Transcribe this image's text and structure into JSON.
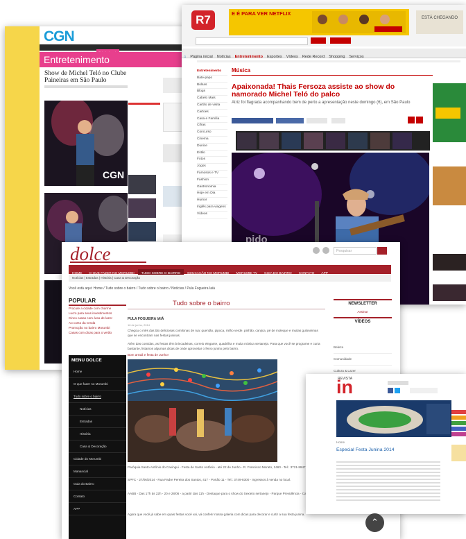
{
  "cgn": {
    "logo": "CGN",
    "nav": [
      "Home",
      "Cidades",
      "Concurso",
      "Esportes",
      "Entretenimento",
      "Blog Metropole",
      "Vídeos"
    ],
    "active_nav": "Entretenimento",
    "section": "Entretenimento",
    "headline": "Show de Michel Teló no Clube Paineiras em São Paulo"
  },
  "r7": {
    "logo": "R7",
    "banner_text": "E É PARA VER NETFLIX",
    "banner2": "ESTÁ CHEGANDO",
    "nav": [
      "Página inicial",
      "Notícias",
      "Entretenimento",
      "Esportes",
      "Vídeos",
      "Rede Record",
      "Shopping",
      "Serviços"
    ],
    "side_head": "Entretenimento",
    "side": [
      "Bate-papo",
      "Bolsas",
      "Blogs",
      "Cabelo Mais",
      "Cartão de visita",
      "Cartoes",
      "Casa e Família",
      "Cifras",
      "Concurso",
      "Cinema",
      "Dunice",
      "Estilo",
      "Fotos",
      "Jogos",
      "Famosos e TV",
      "Fashion",
      "Gastronomia",
      "Hoje em Dia",
      "Humor",
      "Inglês para viagens",
      "Vídeos"
    ],
    "section": "Música",
    "headline": "Apaixonada! Thais Fersoza assiste ao show do namorado Michel Teló do palco",
    "sub": "Atriz foi flagrada acompanhando bem de perto a apresentação neste domingo (6), em São Paulo"
  },
  "dolce": {
    "logo": "dolce",
    "search_placeholder": "Pesquisar",
    "nav": [
      "HOME",
      "O QUE FAZER NO MORUMBI",
      "TUDO SOBRE O BAIRRO",
      "EDUCAÇÃO NO MORUMBI",
      "MORUMBI TV",
      "GUIA DO BAIRRO",
      "CONTATO",
      "APP"
    ],
    "active_nav": "TUDO SOBRE O BAIRRO",
    "subnav": "Notícias  |  Estradas  |  História  |  Casa & Decoração",
    "breadcrumb": "Você está aqui: Home / Tudo sobre o bairro / Tudo sobre o bairro / Notícias / Pula Fogueira Iaiá",
    "popular_title": "POPULAR",
    "popular_items": [
      "Procure a cidade com charme",
      "Lucro para seus investimentos",
      "Cinco casas com área de lazer",
      "Ao curso da venda",
      "Promoção no bairro Morumbi",
      "Casas com dicas para o verão"
    ],
    "menu_title": "MENU DOLCE",
    "menu_items": [
      "Home",
      "O que fazer no Morumbi",
      "Tudo sobre o bairro",
      "Notícias",
      "Estradas",
      "História",
      "Casa & Decoração",
      "Cidade do Morumbi",
      "Manancial",
      "Guia do Bairro",
      "Contato",
      "APP"
    ],
    "page_title": "Tudo sobre o bairro",
    "article_title": "PULA FOGUEIRA IAIÁ",
    "article_date": "16 de junho, 2014",
    "para1": "Chegou o mês das tão deliciosas comilonas de rua: quentão, pipoca, milho verde, pinhão, canjica, pé de moleque e muitas guloseimas que se encontram nas festas juninas.",
    "para2": "Além das comidas, as festas têm brincadeiras, correio elegante, quadrilha e muita música sertaneja. Para que você se programe e curta bastante, listamos algumas dicas de onde aproveitar o fervo junino pelo bairro.",
    "para3": "Bom arraiá e festa de Junho!",
    "newsletter": "NEWSLETTER",
    "newsletter_link": "Assinar",
    "videos_title": "VÍDEOS",
    "right_items": [
      "Beleza",
      "Comunidade",
      "Cultura & Lazer",
      "Decoração"
    ],
    "addr1": "Paróquia Santo Antônio do Caxingui - Festa de Santo Antônio - até 22 de Junho - R. Francisco Morato, 2460 - Tel.: 3721-8947",
    "addr2": "SPFC - 27/06/2014 - Rua Padre Pereira dos Santos, 417 - Portão 11 - Tel.: 3749-8300 - Ingressos à venda no local.",
    "addr3": "AABB - Das 17h às 22h - 20 e 28/06 - a partir das 11h - Destaque para o show do Sexteto sertanejo - Parque Previdência - Campo Limpo - Tel.: 3611-5555",
    "addr4": "Agora que você já sabe em quais festas você vai, vá conferir nossa galeria com dicas para decorar e curtir a sua festa junina."
  },
  "revista_in": {
    "logo": "in",
    "small_logo": "REVISTA",
    "header": "Home",
    "title": "Especial Festa Junina 2014"
  },
  "scroll_icon": "chevron-up-icon",
  "colors": {
    "cgn_pink": "#e83f8d",
    "r7_red": "#d3232a",
    "dolce_red": "#a5212a",
    "cgn_yellow": "#f6d64a"
  }
}
